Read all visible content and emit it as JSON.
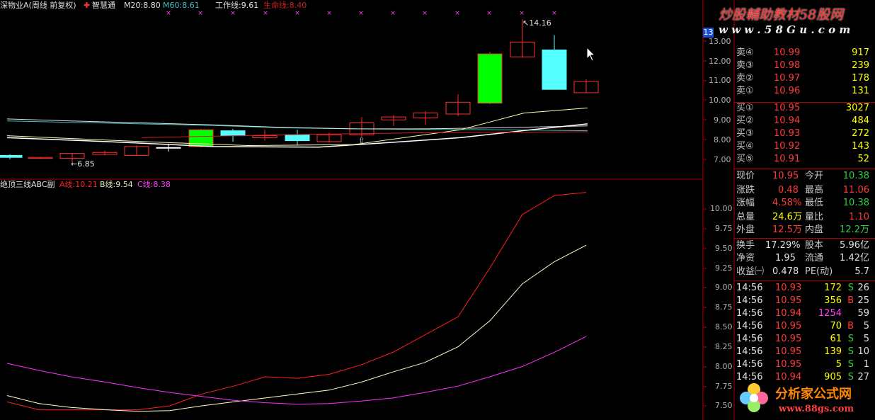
{
  "header": {
    "stock_title": "深物业A(周线 前复权)",
    "zhihui_icon_label": "智慧通",
    "ma20": "M20:8.80",
    "ma60": "M60:8.61",
    "work_line": "工作线:9.61",
    "life_line": "生命线:8.40"
  },
  "top_axis": {
    "ticks": [
      "13.00",
      "12.00",
      "11.00",
      "10.00",
      "9.00",
      "8.00",
      "7.00"
    ],
    "current_tag": "13"
  },
  "annotations": {
    "high_label": "14.16",
    "low_label": "6.85"
  },
  "indicator": {
    "title": "绝顶三线ABC副",
    "a_label": "A线:10.21",
    "b_label": "B线:9.54",
    "c_label": "C线:8.38",
    "ticks": [
      "10.00",
      "9.75",
      "9.50",
      "9.25",
      "9.00",
      "8.75",
      "8.50",
      "8.25",
      "8.00",
      "7.75",
      "7.50"
    ]
  },
  "colors": {
    "up_candle": "#ff3030",
    "down_candle_cyan": "#55ffff",
    "up_candle_green": "#00ff00",
    "a_line": "#ff2020",
    "b_line": "#ffffcc",
    "c_line": "#ff30ff",
    "divider": "#b00000"
  },
  "order_book": {
    "sells": [
      {
        "label": "卖④",
        "price": "10.99",
        "vol": "917"
      },
      {
        "label": "卖③",
        "price": "10.98",
        "vol": "239"
      },
      {
        "label": "卖②",
        "price": "10.97",
        "vol": "178"
      },
      {
        "label": "卖①",
        "price": "10.96",
        "vol": "131"
      }
    ],
    "buys": [
      {
        "label": "买①",
        "price": "10.95",
        "vol": "3027"
      },
      {
        "label": "买②",
        "price": "10.94",
        "vol": "484"
      },
      {
        "label": "买③",
        "price": "10.93",
        "vol": "272"
      },
      {
        "label": "买④",
        "price": "10.92",
        "vol": "143"
      },
      {
        "label": "买⑤",
        "price": "10.91",
        "vol": "52"
      }
    ]
  },
  "stats": {
    "xianjia_label": "现价",
    "xianjia": "10.95",
    "jinkai_label": "今开",
    "jinkai": "10.38",
    "zhangdie_label": "涨跌",
    "zhangdie": "0.48",
    "zuigao_label": "最高",
    "zuigao": "11.06",
    "zhangfu_label": "涨幅",
    "zhangfu": "4.58%",
    "zuidi_label": "最低",
    "zuidi": "10.38",
    "zongliang_label": "总量",
    "zongliang": "24.6万",
    "liangbi_label": "量比",
    "liangbi": "1.10",
    "waipan_label": "外盘",
    "waipan": "12.5万",
    "neipan_label": "内盘",
    "neipan": "12.2万",
    "huanshou_label": "换手",
    "huanshou": "17.29%",
    "guben_label": "股本",
    "guben": "5.96亿",
    "jingzi_label": "净资",
    "jingzi": "1.95",
    "liutong_label": "流通",
    "liutong": "1.42亿",
    "shouyi_label": "收益㈠",
    "shouyi": "0.478",
    "pe_label": "PE(动)",
    "pe": "5.7"
  },
  "ticks": [
    {
      "time": "14:56",
      "price": "10.93",
      "vol": "172",
      "bs": "S",
      "num": "26"
    },
    {
      "time": "14:56",
      "price": "10.95",
      "vol": "356",
      "bs": "B",
      "num": "25"
    },
    {
      "time": "14:56",
      "price": "10.94",
      "vol": "1254",
      "bs": "",
      "num": "59"
    },
    {
      "time": "14:56",
      "price": "10.95",
      "vol": "70",
      "bs": "B",
      "num": "5"
    },
    {
      "time": "14:56",
      "price": "10.95",
      "vol": "61",
      "bs": "S",
      "num": "5"
    },
    {
      "time": "14:56",
      "price": "10.95",
      "vol": "139",
      "bs": "S",
      "num": "10"
    },
    {
      "time": "14:56",
      "price": "10.95",
      "vol": "5",
      "bs": "S",
      "num": "1"
    },
    {
      "time": "14:56",
      "price": "10.94",
      "vol": "905",
      "bs": "S",
      "num": "27"
    }
  ],
  "watermarks": {
    "top_text": "炒股輔助教材58股网",
    "top_url": "w w w . 5 8 G u . c o m",
    "bottom_text": "分析家公式网",
    "bottom_url": "www.88gs.com"
  }
}
